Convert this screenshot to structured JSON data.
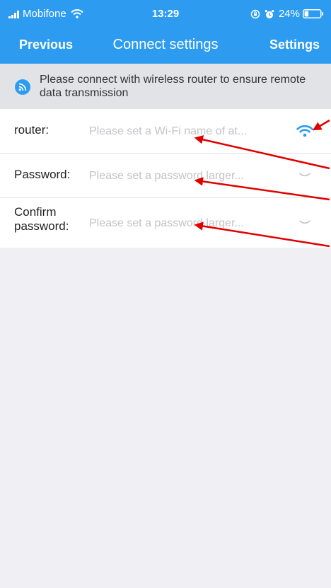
{
  "status_bar": {
    "carrier": "Mobifone",
    "time": "13:29",
    "battery": "24%"
  },
  "nav": {
    "back_label": "Previous",
    "title": "Connect settings",
    "settings_label": "Settings"
  },
  "notice": {
    "text": "Please connect with wireless router to ensure remote data transmission"
  },
  "form": {
    "router": {
      "label": "router:",
      "placeholder": "Please set a Wi-Fi name of at..."
    },
    "password": {
      "label": "Password:",
      "placeholder": "Please set a password larger..."
    },
    "confirm": {
      "label_line1": "Confirm",
      "label_line2": "password:",
      "placeholder": "Please set a password larger..."
    }
  },
  "icons": {
    "notice": "wifi-signal-icon",
    "router": "wifi-icon",
    "password": "eye-closed-icon",
    "confirm": "eye-closed-icon"
  },
  "colors": {
    "accent": "#2d9cf0",
    "annotation": "#e00000"
  }
}
